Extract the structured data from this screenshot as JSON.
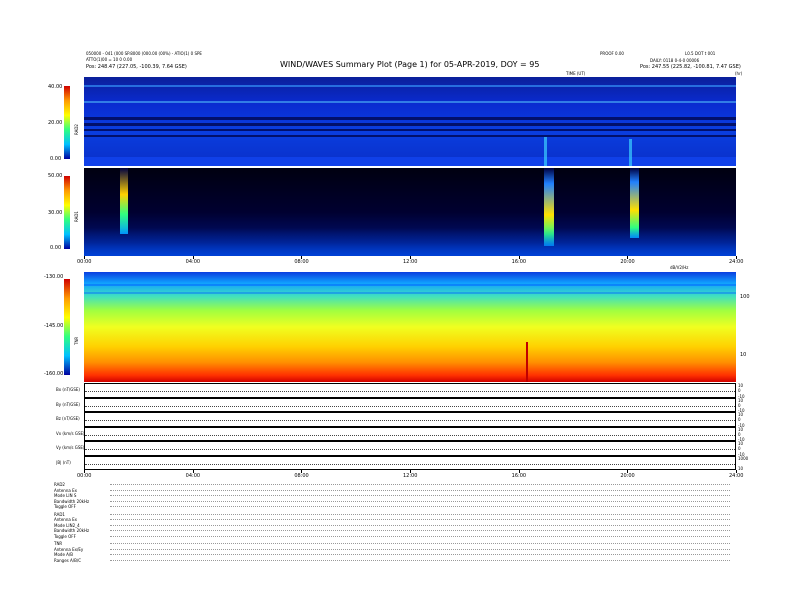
{
  "header": {
    "title": "WIND/WAVES Summary Plot (Page 1) for 05-APR-2019, DOY = 95",
    "left_line1": "050000 - 041 (000 SP.8000 (000.00 (00%) - ATIO(1) 0 SPE",
    "left_line2": "ATTO(1)00 = 10 0 0.00",
    "left_pos": "Pos:   248.47 (227.05, -100.39, 7.64 GSE)",
    "right_top1": "PROOF 0.00",
    "right_top2": "L0.5 DOT t 001",
    "right_mid": "DAILY: 0118 0-4-0 00006",
    "right_pos": "Pos:   247.55 (225.82, -100.81, 7.47 GSE)",
    "time_label": "TIME (UT)",
    "hrs_label": "(hr)"
  },
  "panels": {
    "rad2": {
      "label": "RAD2",
      "ticks": [
        "40.00",
        "20.00",
        "0.00"
      ]
    },
    "rad1": {
      "label": "RAD1",
      "ticks": [
        "50.00",
        "30.00",
        "0.00"
      ]
    },
    "tnr": {
      "label": "TNR",
      "ticks": [
        "-130.00",
        "-145.00",
        "-160.00"
      ],
      "right_ticks": [
        "100",
        "10"
      ],
      "units_label": "dB/V2/Hz"
    },
    "xaxis_top": [
      "00:00",
      "04:00",
      "08:00",
      "12:00",
      "16:00",
      "20:00",
      "24:00"
    ],
    "xaxis_bottom": [
      "00:00",
      "04:00",
      "08:00",
      "12:00",
      "16:00",
      "20:00",
      "24:00"
    ]
  },
  "line_panels": [
    {
      "label": "Bx (nT/GSE)",
      "right": [
        "10",
        "0",
        "-10"
      ]
    },
    {
      "label": "By (nT/GSE)",
      "right": [
        "10",
        "0",
        "-10"
      ]
    },
    {
      "label": "Bz (nT/GSE)",
      "right": [
        "10",
        "0",
        "-10"
      ]
    },
    {
      "label": "Vx (km/s GSE)",
      "right": [
        "10",
        "0",
        "-10"
      ]
    },
    {
      "label": "Vy (km/s GSE)",
      "right": [
        "10",
        "0",
        "-10"
      ]
    },
    {
      "label": "|B| (nT)",
      "right": [
        "1000",
        "10"
      ]
    }
  ],
  "footer": {
    "rad2": [
      "RAD2",
      "Antenna  Ex",
      "Mode    LIN S",
      "Bandwidth 20kHz",
      "Toggle  OFF"
    ],
    "rad1": [
      "RAD1",
      "Antenna  Ex",
      "Mode    LIN2_4",
      "Bandwidth 20kHz",
      "Toggle  OFF"
    ],
    "tnr": [
      "TNR",
      "Antenna  Ex/Ey",
      "Mode    A/B",
      "Ranges  A/B/C"
    ]
  },
  "colors": {
    "bg_dark": "#00008b",
    "accent": "#ff0000"
  },
  "chart_data": [
    {
      "type": "heatmap",
      "title": "WIND/WAVES Summary Plot (Page 1) for 05-APR-2019, DOY = 95",
      "ylabel": "RAD2",
      "ylim": [
        0,
        40
      ],
      "xlabel": "TIME (UT)",
      "x_ticks": [
        "00:00",
        "04:00",
        "08:00",
        "12:00",
        "16:00",
        "20:00",
        "24:00"
      ]
    },
    {
      "type": "heatmap",
      "ylabel": "RAD1",
      "ylim": [
        0,
        50
      ],
      "x_ticks": [
        "00:00",
        "04:00",
        "08:00",
        "12:00",
        "16:00",
        "20:00",
        "24:00"
      ]
    },
    {
      "type": "heatmap",
      "ylabel": "TNR",
      "ylim": [
        -160,
        -130
      ],
      "x_ticks": [
        "00:00",
        "04:00",
        "08:00",
        "12:00",
        "16:00",
        "20:00",
        "24:00"
      ]
    }
  ]
}
